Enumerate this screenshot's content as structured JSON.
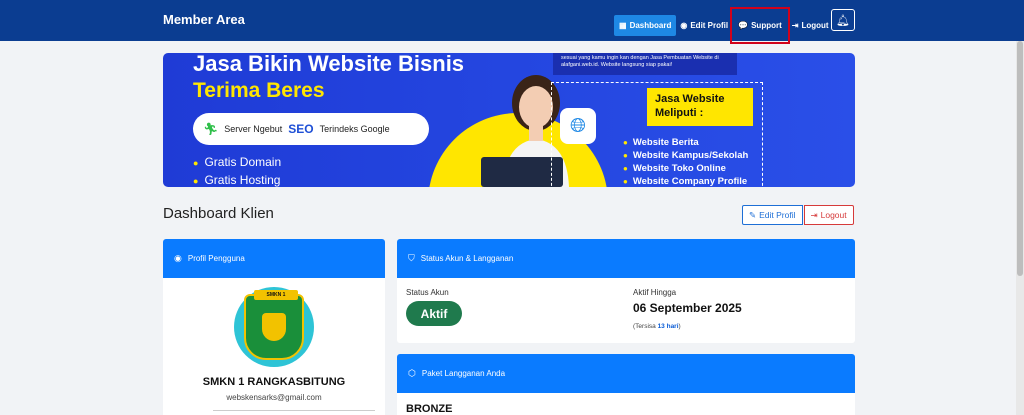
{
  "navbar": {
    "brand": "Member Area",
    "links": [
      {
        "label": "Dashboard",
        "icon": "grid-icon"
      },
      {
        "label": "Edit Profil",
        "icon": "user-circle-icon"
      },
      {
        "label": "Support",
        "icon": "chat-icon"
      },
      {
        "label": "Logout",
        "icon": "logout-icon"
      }
    ],
    "bell_icon": "bell-icon",
    "highlight_color": "#d0021b"
  },
  "banner": {
    "title_line1": "Jasa Bikin Website Bisnis",
    "title_line2": "Terima Beres",
    "pill_item1": "Server Ngebut",
    "pill_seo": "SEO",
    "pill_item2": "Terindeks Google",
    "bullets": [
      "Gratis Domain",
      "Gratis Hosting"
    ],
    "top_box_text": "sesuai yang kamu ingin kan dengan Jasa Pembuatan Website di alafgani.web.id. Website langsung siap pakai!",
    "yellow_box_text": "Jasa Website Meliputi :",
    "services": [
      "Website Berita",
      "Website Kampus/Sekolah",
      "Website Toko Online",
      "Website Company Profile"
    ]
  },
  "page": {
    "title": "Dashboard Klien",
    "edit_button": "Edit Profil",
    "logout_button": "Logout"
  },
  "profile_card": {
    "heading": "Profil Pengguna",
    "avatar_label": "SMKN 1",
    "name": "SMKN 1 RANGKASBITUNG",
    "email": "webskensarks@gmail.com"
  },
  "status_card": {
    "heading": "Status Akun & Langganan",
    "status_label": "Status Akun",
    "status_value": "Aktif",
    "active_until_label": "Aktif Hingga",
    "active_until_value": "06 September 2025",
    "remaining_prefix": "(Tersisa ",
    "remaining_value": "13 hari",
    "remaining_suffix": ")"
  },
  "package_card": {
    "heading": "Paket Langganan Anda",
    "package_name": "BRONZE"
  },
  "colors": {
    "navbar": "#0b3d91",
    "card_header": "#0a7bff",
    "active_badge": "#1f7a4d",
    "banner_blue": "#2446e0",
    "banner_yellow": "#ffe600"
  }
}
